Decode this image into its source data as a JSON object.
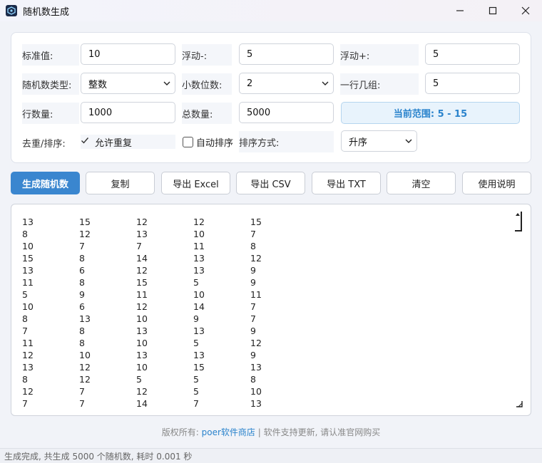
{
  "window": {
    "title": "随机数生成",
    "controls": {
      "minimize": "—",
      "maximize": "☐",
      "close": "✕"
    }
  },
  "form": {
    "base_label": "标准值:",
    "base_value": "10",
    "float_minus_label": "浮动-:",
    "float_minus_value": "5",
    "float_plus_label": "浮动+:",
    "float_plus_value": "5",
    "type_label": "随机数类型:",
    "type_value": "整数",
    "decimals_label": "小数位数:",
    "decimals_value": "2",
    "per_row_label": "一行几组:",
    "per_row_value": "5",
    "rows_label": "行数量:",
    "rows_value": "1000",
    "total_label": "总数量:",
    "total_value": "5000",
    "range_text": "当前范围: 5 - 15",
    "dedupe_label": "去重/排序:",
    "allow_dup_label": "允许重复",
    "auto_sort_label": "自动排序",
    "sort_mode_label": "排序方式:",
    "sort_mode_value": "升序"
  },
  "buttons": {
    "generate": "生成随机数",
    "copy": "复制",
    "export_excel": "导出 Excel",
    "export_csv": "导出 CSV",
    "export_txt": "导出 TXT",
    "clear": "清空",
    "help": "使用说明"
  },
  "output_rows": [
    [
      "13",
      "15",
      "12",
      "12",
      "15"
    ],
    [
      "8",
      "12",
      "13",
      "10",
      "7"
    ],
    [
      "10",
      "7",
      "7",
      "11",
      "8"
    ],
    [
      "15",
      "8",
      "14",
      "13",
      "12"
    ],
    [
      "13",
      "6",
      "12",
      "13",
      "9"
    ],
    [
      "11",
      "8",
      "15",
      "5",
      "9"
    ],
    [
      "5",
      "9",
      "11",
      "10",
      "11"
    ],
    [
      "10",
      "6",
      "12",
      "14",
      "7"
    ],
    [
      "8",
      "13",
      "10",
      "9",
      "7"
    ],
    [
      "7",
      "8",
      "13",
      "13",
      "9"
    ],
    [
      "11",
      "8",
      "10",
      "5",
      "12"
    ],
    [
      "12",
      "10",
      "13",
      "13",
      "9"
    ],
    [
      "13",
      "12",
      "10",
      "15",
      "13"
    ],
    [
      "8",
      "12",
      "5",
      "5",
      "8"
    ],
    [
      "12",
      "7",
      "12",
      "5",
      "10"
    ],
    [
      "7",
      "7",
      "14",
      "7",
      "13"
    ]
  ],
  "footer": {
    "prefix": "版权所有:",
    "link": "poer软件商店",
    "suffix": " | 软件支持更新, 请认准官网购买"
  },
  "status": "生成完成, 共生成 5000 个随机数, 耗时 0.001 秒",
  "colors": {
    "accent": "#3a86cf",
    "range_text": "#2a83cc"
  }
}
